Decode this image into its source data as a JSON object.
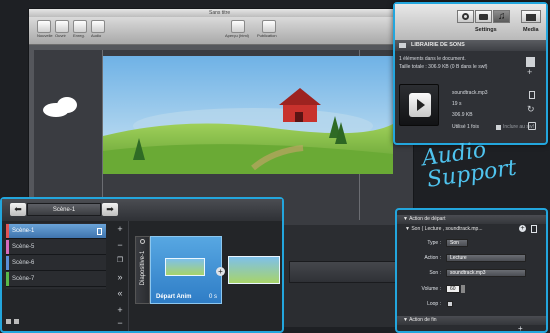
{
  "window": {
    "title": "Sans titre",
    "toolbar": [
      {
        "label": "Nouvelle",
        "icon": "new-icon"
      },
      {
        "label": "Ouvrir",
        "icon": "open-icon"
      },
      {
        "label": "Enreg.",
        "icon": "save-icon"
      },
      {
        "label": "Audio",
        "icon": "audio-icon"
      },
      {
        "label": "Aperçu (html)",
        "icon": "preview-icon"
      },
      {
        "label": "Publication",
        "icon": "publish-icon"
      }
    ]
  },
  "library": {
    "tabs": [
      {
        "label": "",
        "icon": "gear-icon"
      },
      {
        "label": "",
        "icon": "camera-icon"
      },
      {
        "label": "Settings",
        "icon": "music-icon"
      },
      {
        "label": "Media",
        "icon": "film-icon"
      }
    ],
    "title": "LIBRAIRIE DE SONS",
    "count_text": "1 éléments dans le document.",
    "size_text": "Taille totale : 306.9 KB (0 B dans le swf)",
    "item": {
      "filename": "soundtrack.mp3",
      "duration": "19 s",
      "size": "306.9 KB",
      "usage": "Utilisé 1 fois",
      "include": "Inclure au swf"
    }
  },
  "banner": {
    "line1": "Audio",
    "line2": "Support"
  },
  "scenes": {
    "current": "Scène-1",
    "list": [
      {
        "label": "Scène-1",
        "color": "#e05555",
        "selected": true
      },
      {
        "label": "Scène-5",
        "color": "#d56bbf",
        "selected": false
      },
      {
        "label": "Scène-6",
        "color": "#5b8fd8",
        "selected": false
      },
      {
        "label": "Scène-7",
        "color": "#59b84a",
        "selected": false
      }
    ],
    "slide_label": "Diapositive-1",
    "anim_label": "Départ Anim",
    "anim_time": "0 s"
  },
  "properties": {
    "section1": "Action de départ",
    "subsection": "Son ( Lecture , soundtrack.mp...",
    "fields": [
      {
        "label": "Type :",
        "value": "Son"
      },
      {
        "label": "Action :",
        "value": "Lecture"
      },
      {
        "label": "Son :",
        "value": "soundtrack.mp3"
      }
    ],
    "volume_label": "Volume :",
    "volume_value": "60",
    "loop_label": "Loop :",
    "section2": "Action de fin"
  },
  "colors": {
    "accent": "#23a6dd",
    "selected": "#3f74ad"
  }
}
